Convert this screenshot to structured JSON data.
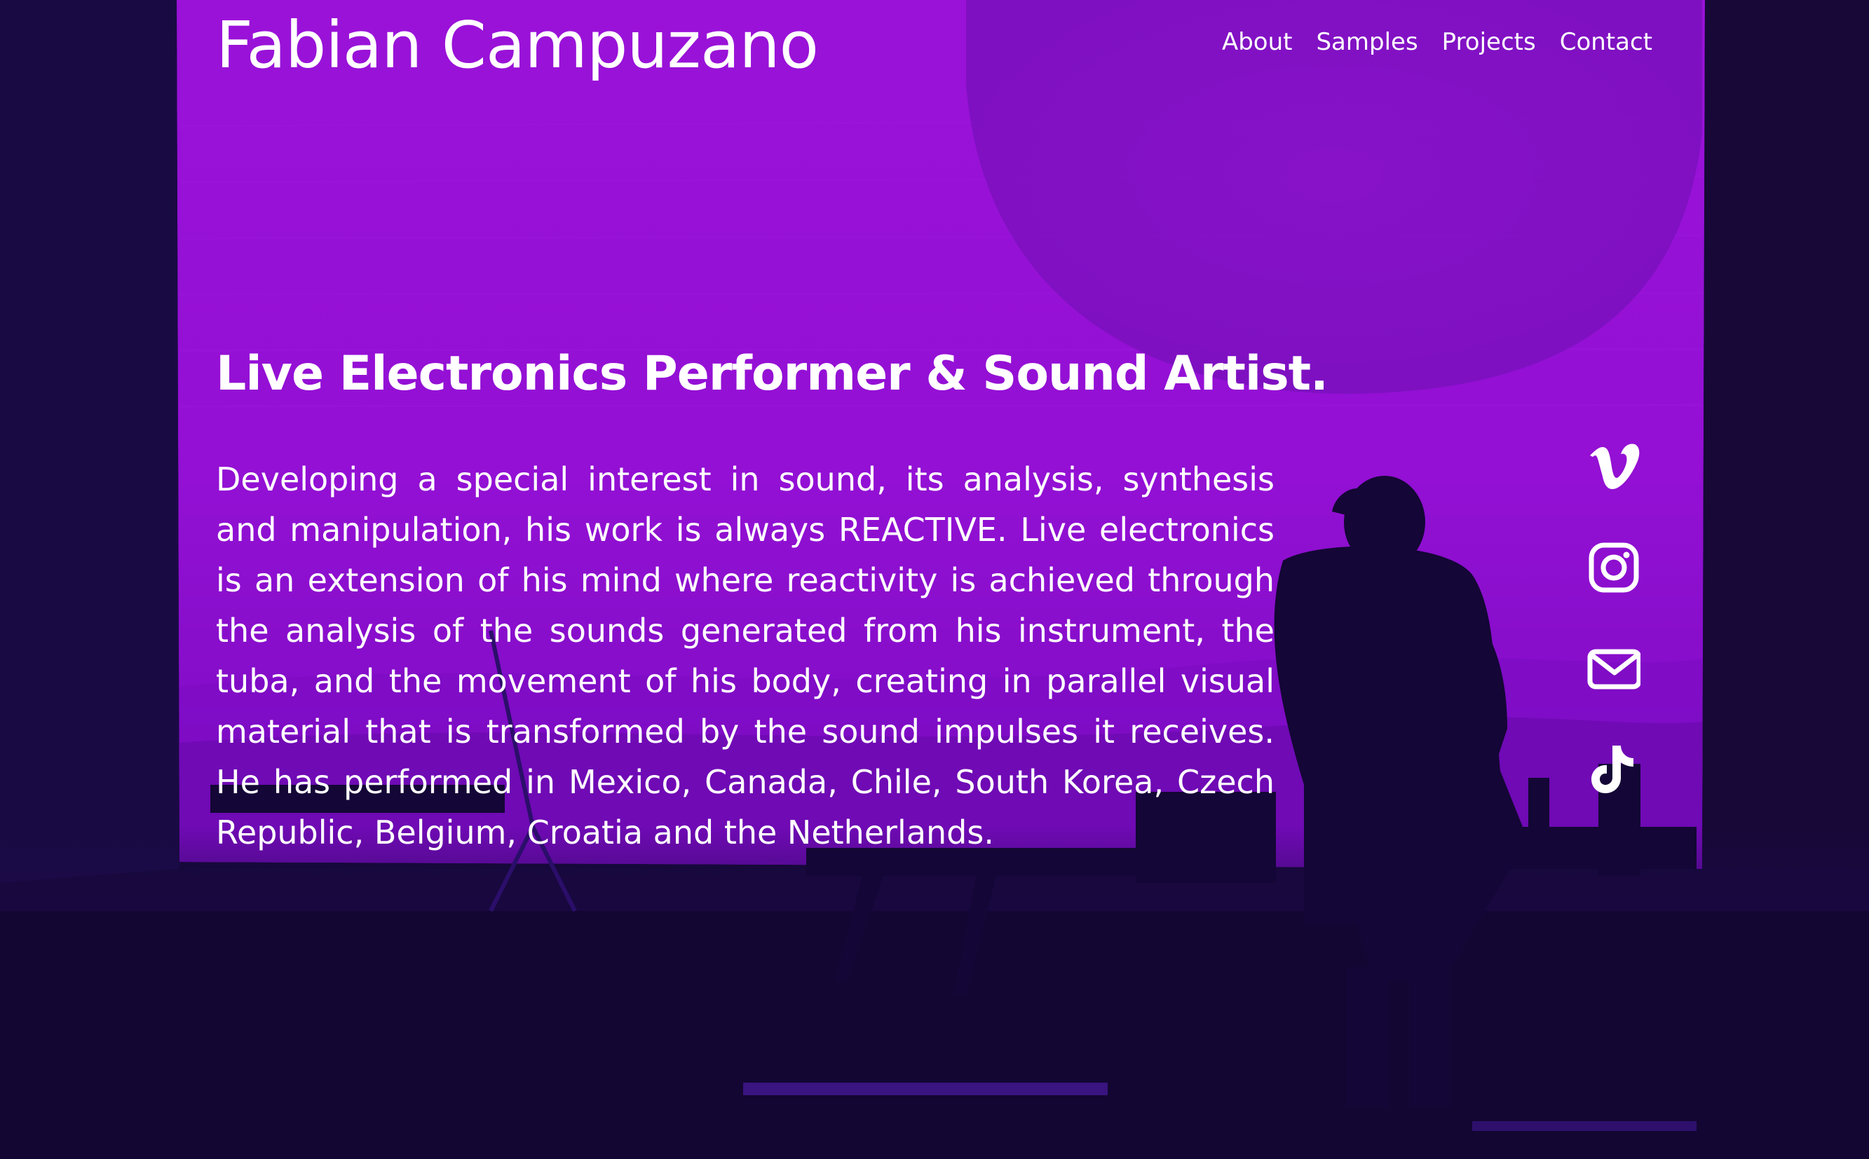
{
  "site": {
    "title": "Fabian Campuzano"
  },
  "nav": {
    "items": [
      {
        "label": "About"
      },
      {
        "label": "Samples"
      },
      {
        "label": "Projects"
      },
      {
        "label": "Contact"
      }
    ]
  },
  "hero": {
    "tagline": "Live Electronics Performer & Sound Artist.",
    "bio": "Developing a special interest in sound, its analysis, synthesis and manipulation, his work is always REACTIVE. Live electronics is an extension of his mind where reactivity is achieved through the analysis of the sounds generated from his instrument, the tuba, and the movement of his body, creating in parallel visual material that is transformed by the sound impulses it receives. He has performed in Mexico, Canada, Chile, South Korea, Czech Republic, Belgium, Croatia and the Netherlands."
  },
  "social": {
    "icons": [
      "vimeo-icon",
      "instagram-icon",
      "email-icon",
      "tiktok-icon"
    ]
  },
  "colors": {
    "accent_purple": "#9410d6",
    "dark_background": "#150838",
    "text": "#ffffff"
  }
}
